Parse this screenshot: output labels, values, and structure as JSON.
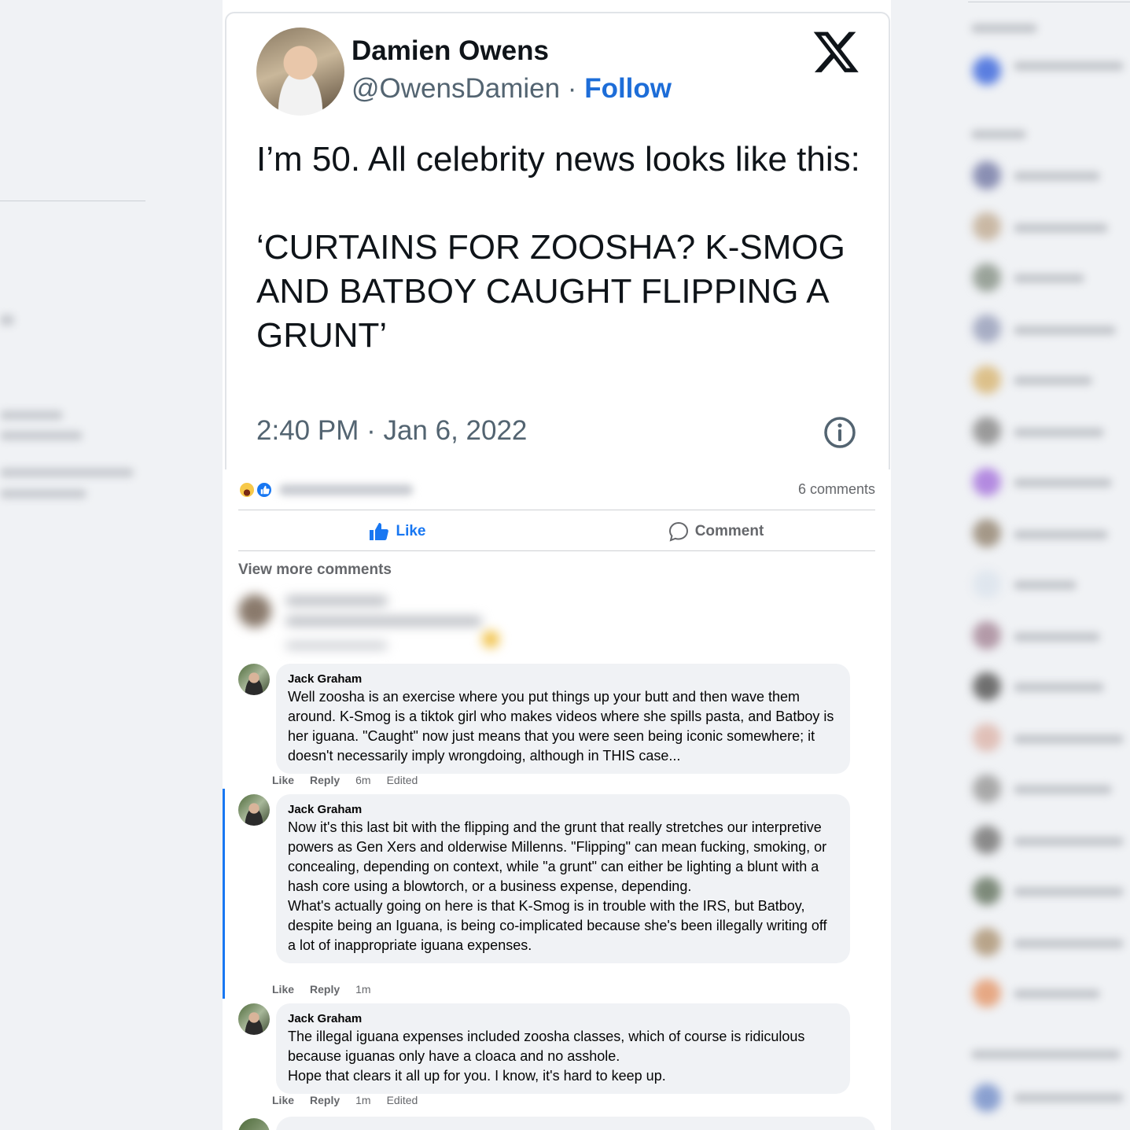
{
  "tweet": {
    "name": "Damien Owens",
    "handle": "@OwensDamien",
    "separator": " · ",
    "follow": "Follow",
    "text": "I’m 50. All celebrity news looks like this:\n\n‘CURTAINS FOR ZOOSHA? K-SMOG AND BATBOY CAUGHT FLIPPING A GRUNT’",
    "timestamp": "2:40 PM · Jan 6, 2022"
  },
  "post": {
    "comment_count": "6 comments",
    "like_label": "Like",
    "comment_label": "Comment",
    "view_more": "View more comments"
  },
  "comments": [
    {
      "author": "Jack Graham",
      "text": "Well zoosha is an exercise where you put things up your butt and then wave them around. K-Smog is a tiktok girl who makes videos where she spills pasta, and Batboy is her iguana. \"Caught\" now just means that you were seen being iconic somewhere; it doesn't necessarily imply wrongdoing, although in THIS case...",
      "like": "Like",
      "reply": "Reply",
      "time": "6m",
      "edited": "Edited"
    },
    {
      "author": "Jack Graham",
      "text": "Now it's this last bit with the flipping and the grunt that really stretches our interpretive powers as Gen Xers and olderwise Millenns. \"Flipping\" can mean fucking, smoking, or concealing, depending on context, while \"a grunt\" can either be lighting a blunt with a hash core using a blowtorch, or a business expense, depending.",
      "text2": "What's actually going on here is that K-Smog is in trouble with the IRS, but Batboy, despite being an Iguana, is being co-implicated because she's been illegally writing off a lot of inappropriate iguana expenses.",
      "like": "Like",
      "reply": "Reply",
      "time": "1m"
    },
    {
      "author": "Jack Graham",
      "text": "The illegal iguana expenses included zoosha classes, which of course is ridiculous because iguanas only have a cloaca and no asshole.",
      "text2": "Hope that clears it all up for you. I know, it's hard to keep up.",
      "like": "Like",
      "reply": "Reply",
      "time": "1m",
      "edited": "Edited"
    }
  ],
  "colors": {
    "link_blue": "#1877f2",
    "follow_blue": "#1d6dd8",
    "muted": "#65676b",
    "bubble": "#f0f2f5"
  }
}
